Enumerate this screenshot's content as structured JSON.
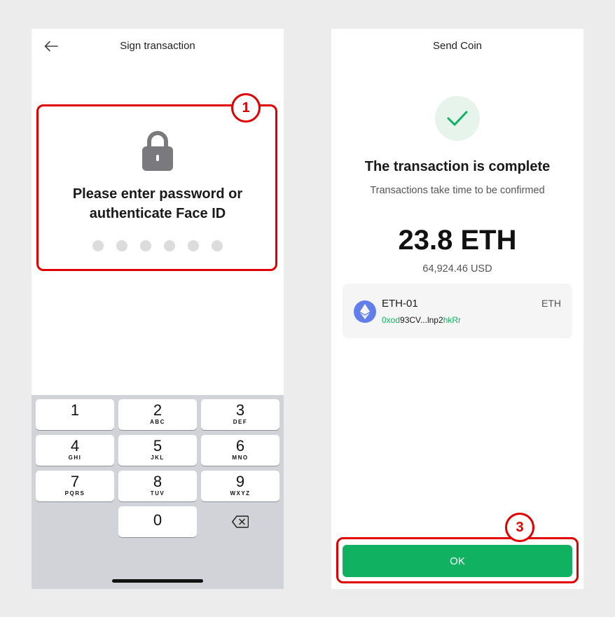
{
  "sign_screen": {
    "title": "Sign transaction",
    "prompt_line1": "Please enter password or",
    "prompt_line2": "authenticate Face ID",
    "pin_dots": 6,
    "keypad": {
      "keys": [
        {
          "num": "1",
          "letters": ""
        },
        {
          "num": "2",
          "letters": "ABC"
        },
        {
          "num": "3",
          "letters": "DEF"
        },
        {
          "num": "4",
          "letters": "GHI"
        },
        {
          "num": "5",
          "letters": "JKL"
        },
        {
          "num": "6",
          "letters": "MNO"
        },
        {
          "num": "7",
          "letters": "PQRS"
        },
        {
          "num": "8",
          "letters": "TUV"
        },
        {
          "num": "9",
          "letters": "WXYZ"
        },
        {
          "num": "0",
          "letters": ""
        }
      ]
    }
  },
  "send_screen": {
    "title": "Send Coin",
    "complete_title": "The transaction is complete",
    "complete_subtitle": "Transactions take time to be confirmed",
    "amount": "23.8 ETH",
    "amount_usd": "64,924.46 USD",
    "wallet": {
      "name": "ETH-01",
      "symbol": "ETH",
      "address_prefix": "0xod",
      "address_middle": "93CV...lnp2",
      "address_suffix": "hkRr"
    },
    "ok_label": "OK"
  },
  "annotations": {
    "badge_1": "1",
    "badge_3": "3"
  },
  "colors": {
    "accent_green": "#10b160",
    "annotation_red": "#e00000",
    "eth_blue": "#627eea"
  },
  "icons": [
    "back-arrow-icon",
    "lock-icon",
    "delete-key-icon",
    "checkmark-icon",
    "ethereum-icon"
  ]
}
